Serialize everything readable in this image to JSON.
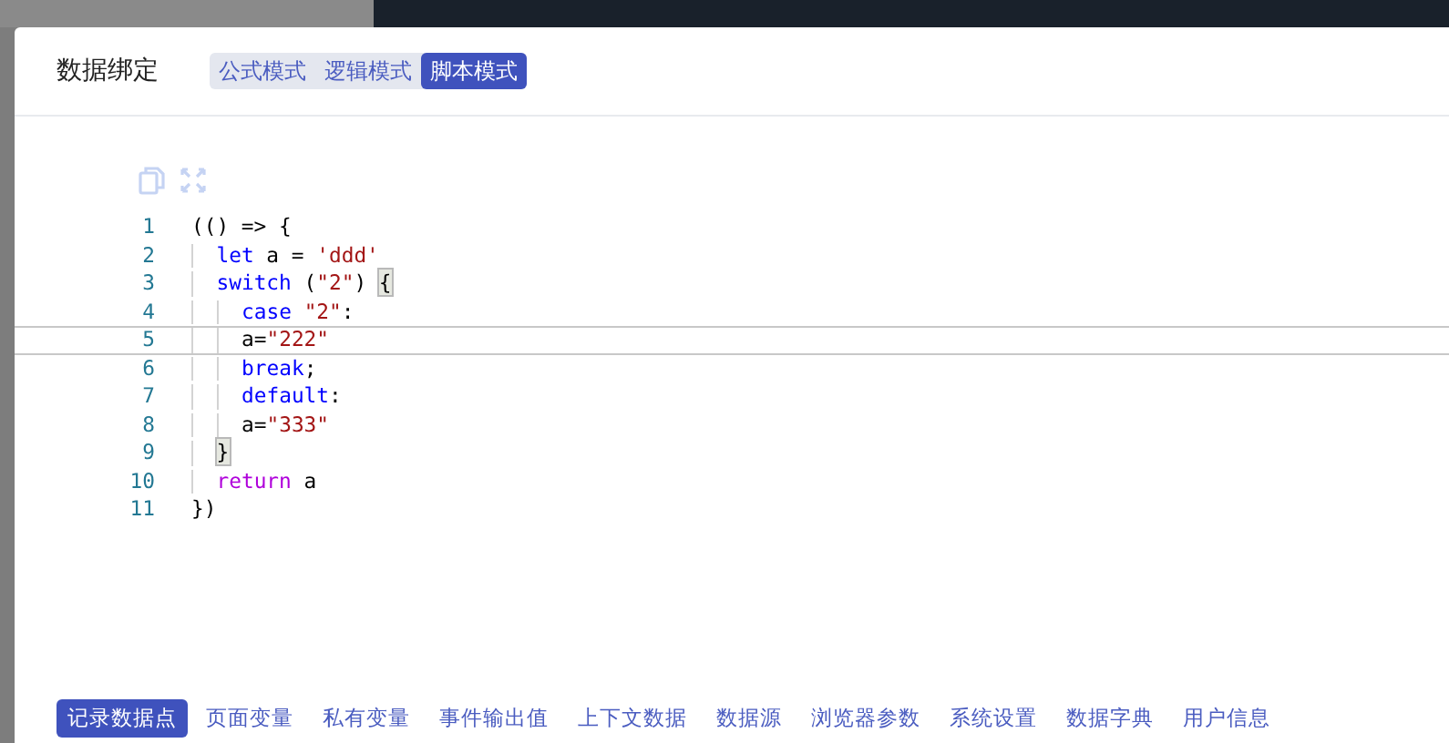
{
  "dialog": {
    "title": "数据绑定"
  },
  "mode_tabs": [
    {
      "label": "公式模式",
      "selected": false
    },
    {
      "label": "逻辑模式",
      "selected": false
    },
    {
      "label": "脚本模式",
      "selected": true
    }
  ],
  "editor": {
    "lines": [
      {
        "number": "1",
        "current": false,
        "tokens": [
          {
            "kind": "plain",
            "text": "(() => {"
          }
        ],
        "children": [
          {
            "number": "2",
            "current": false,
            "tokens": [
              {
                "kind": "keyword",
                "text": "let"
              },
              {
                "kind": "plain",
                "text": " a = "
              },
              {
                "kind": "string",
                "text": "'ddd'"
              }
            ]
          },
          {
            "number": "3",
            "current": false,
            "tokens": [
              {
                "kind": "keyword",
                "text": "switch"
              },
              {
                "kind": "plain",
                "text": " ("
              },
              {
                "kind": "string",
                "text": "\"2\""
              },
              {
                "kind": "plain",
                "text": ") "
              },
              {
                "kind": "match",
                "text": "{"
              }
            ],
            "children": [
              {
                "number": "4",
                "current": false,
                "tokens": [
                  {
                    "kind": "keyword",
                    "text": "case "
                  },
                  {
                    "kind": "string",
                    "text": "\"2\""
                  },
                  {
                    "kind": "plain",
                    "text": ":"
                  }
                ]
              },
              {
                "number": "5",
                "current": true,
                "tokens": [
                  {
                    "kind": "plain",
                    "text": "a="
                  },
                  {
                    "kind": "string",
                    "text": "\"222\""
                  }
                ]
              },
              {
                "number": "6",
                "current": false,
                "tokens": [
                  {
                    "kind": "keyword",
                    "text": "break"
                  },
                  {
                    "kind": "plain",
                    "text": ";"
                  }
                ]
              },
              {
                "number": "7",
                "current": false,
                "tokens": [
                  {
                    "kind": "keyword",
                    "text": "default"
                  },
                  {
                    "kind": "plain",
                    "text": ":"
                  }
                ]
              },
              {
                "number": "8",
                "current": false,
                "tokens": [
                  {
                    "kind": "plain",
                    "text": "a="
                  },
                  {
                    "kind": "string",
                    "text": "\"333\""
                  }
                ]
              }
            ]
          },
          {
            "number": "9",
            "current": false,
            "tokens": [
              {
                "kind": "match",
                "text": "}"
              }
            ]
          },
          {
            "number": "10",
            "current": false,
            "tokens": [
              {
                "kind": "control",
                "text": "return"
              },
              {
                "kind": "plain",
                "text": " a"
              }
            ]
          }
        ]
      },
      {
        "number": "11",
        "current": false,
        "tokens": [
          {
            "kind": "plain",
            "text": "})"
          }
        ]
      }
    ]
  },
  "source_tabs": [
    {
      "label": "记录数据点",
      "selected": true
    },
    {
      "label": "页面变量",
      "selected": false
    },
    {
      "label": "私有变量",
      "selected": false
    },
    {
      "label": "事件输出值",
      "selected": false
    },
    {
      "label": "上下文数据",
      "selected": false
    },
    {
      "label": "数据源",
      "selected": false
    },
    {
      "label": "浏览器参数",
      "selected": false
    },
    {
      "label": "系统设置",
      "selected": false
    },
    {
      "label": "数据字典",
      "selected": false
    },
    {
      "label": "用户信息",
      "selected": false
    }
  ]
}
